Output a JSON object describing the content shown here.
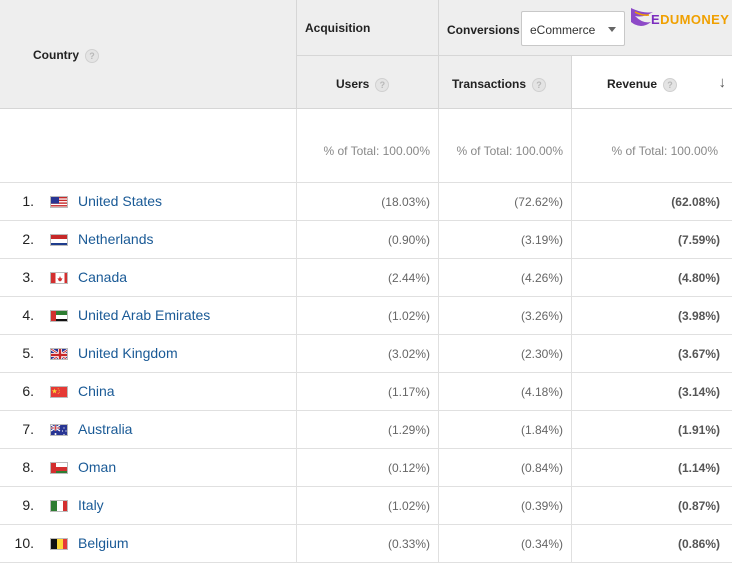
{
  "header": {
    "country_label": "Country",
    "acquisition_label": "Acquisition",
    "conversions_label": "Conversions",
    "conversions_dropdown_value": "eCommerce",
    "users_label": "Users",
    "transactions_label": "Transactions",
    "revenue_label": "Revenue",
    "help_glyph": "?",
    "sort_glyph": "↓"
  },
  "logo": {
    "text_e": "E",
    "text_rest": "DUMONEY",
    "colors": {
      "purple": "#7b2cbf",
      "orange": "#f0a000"
    }
  },
  "totals": {
    "users": "% of Total: 100.00%",
    "transactions": "% of Total: 100.00%",
    "revenue": "% of Total: 100.00%"
  },
  "rows": [
    {
      "rank": "1.",
      "country": "United States",
      "flag": "us-flag",
      "users": "(18.03%)",
      "transactions": "(72.62%)",
      "revenue": "(62.08%)"
    },
    {
      "rank": "2.",
      "country": "Netherlands",
      "flag": "nl-flag",
      "users": "(0.90%)",
      "transactions": "(3.19%)",
      "revenue": "(7.59%)"
    },
    {
      "rank": "3.",
      "country": "Canada",
      "flag": "ca-flag",
      "users": "(2.44%)",
      "transactions": "(4.26%)",
      "revenue": "(4.80%)"
    },
    {
      "rank": "4.",
      "country": "United Arab Emirates",
      "flag": "ae-flag",
      "users": "(1.02%)",
      "transactions": "(3.26%)",
      "revenue": "(3.98%)"
    },
    {
      "rank": "5.",
      "country": "United Kingdom",
      "flag": "gb-flag",
      "users": "(3.02%)",
      "transactions": "(2.30%)",
      "revenue": "(3.67%)"
    },
    {
      "rank": "6.",
      "country": "China",
      "flag": "cn-flag",
      "users": "(1.17%)",
      "transactions": "(4.18%)",
      "revenue": "(3.14%)"
    },
    {
      "rank": "7.",
      "country": "Australia",
      "flag": "au-flag",
      "users": "(1.29%)",
      "transactions": "(1.84%)",
      "revenue": "(1.91%)"
    },
    {
      "rank": "8.",
      "country": "Oman",
      "flag": "om-flag",
      "users": "(0.12%)",
      "transactions": "(0.84%)",
      "revenue": "(1.14%)"
    },
    {
      "rank": "9.",
      "country": "Italy",
      "flag": "it-flag",
      "users": "(1.02%)",
      "transactions": "(0.39%)",
      "revenue": "(0.87%)"
    },
    {
      "rank": "10.",
      "country": "Belgium",
      "flag": "be-flag",
      "users": "(0.33%)",
      "transactions": "(0.34%)",
      "revenue": "(0.86%)"
    }
  ],
  "colors": {
    "link": "#1a5a96",
    "header_bg": "#eeeeee",
    "border": "#e0e0e0"
  }
}
